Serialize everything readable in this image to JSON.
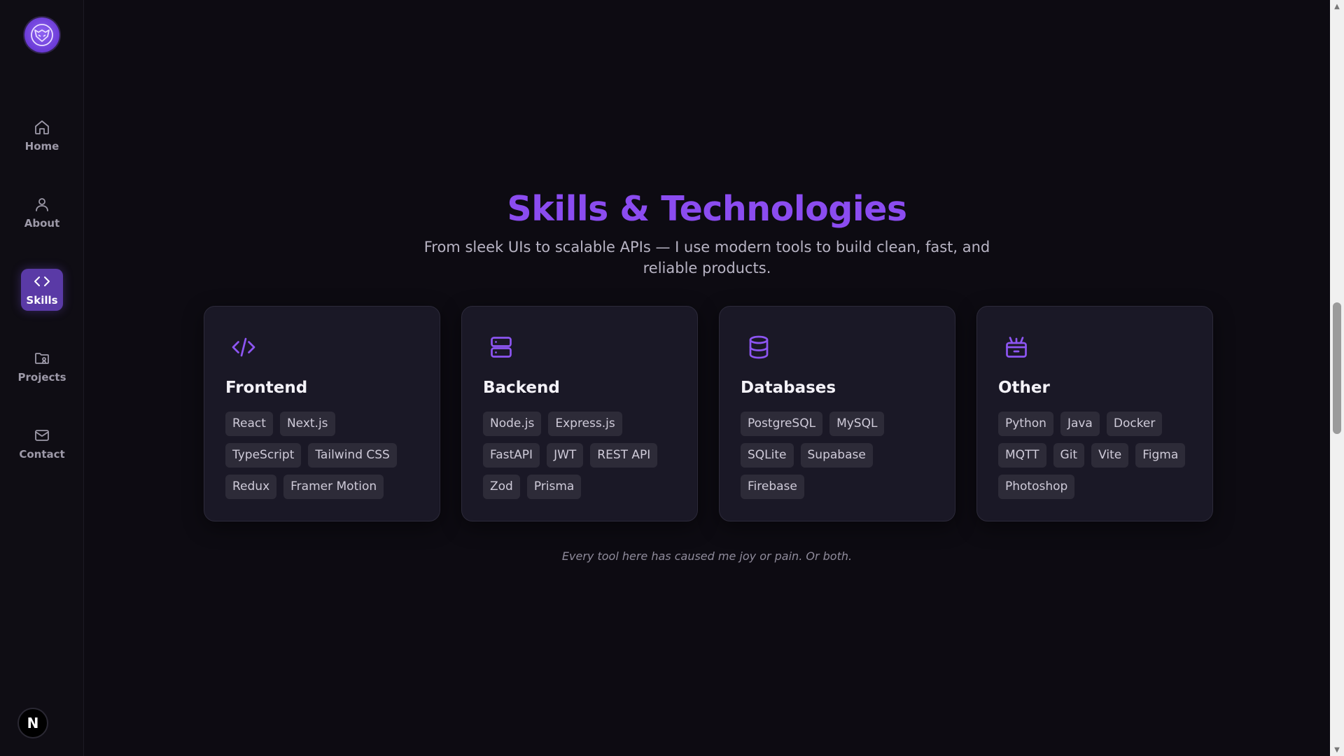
{
  "nav": {
    "items": [
      {
        "label": "Home",
        "icon": "home-icon"
      },
      {
        "label": "About",
        "icon": "user-icon"
      },
      {
        "label": "Skills",
        "icon": "code-icon",
        "active": true
      },
      {
        "label": "Projects",
        "icon": "folder-icon"
      },
      {
        "label": "Contact",
        "icon": "mail-icon"
      }
    ],
    "logo_icon": "avatar-logo",
    "badge_text": "N"
  },
  "main": {
    "title": "Skills & Technologies",
    "subtitle": "From sleek UIs to scalable APIs — I use modern tools to build clean, fast, and reliable products.",
    "footnote": "Every tool here has caused me joy or pain. Or both.",
    "cards": [
      {
        "title": "Frontend",
        "icon": "code-icon",
        "rows": [
          [
            "React",
            "Next.js"
          ],
          [
            "TypeScript",
            "Tailwind CSS"
          ],
          [
            "Redux",
            "Framer Motion"
          ]
        ]
      },
      {
        "title": "Backend",
        "icon": "server-icon",
        "rows": [
          [
            "Node.js",
            "Express.js"
          ],
          [
            "FastAPI",
            "JWT",
            "REST API"
          ],
          [
            "Zod",
            "Prisma"
          ]
        ]
      },
      {
        "title": "Databases",
        "icon": "database-icon",
        "rows": [
          [
            "PostgreSQL",
            "MySQL"
          ],
          [
            "SQLite",
            "Supabase"
          ],
          [
            "Firebase"
          ]
        ]
      },
      {
        "title": "Other",
        "icon": "package-icon",
        "rows": [
          [
            "Python",
            "Java",
            "Docker"
          ],
          [
            "MQTT",
            "Git",
            "Vite",
            "Figma"
          ],
          [
            "Photoshop"
          ]
        ]
      }
    ]
  },
  "colors": {
    "accent": "#8b4cf0",
    "background": "#0d0b12",
    "card": "#1a1826",
    "tag": "#2d2b38"
  }
}
